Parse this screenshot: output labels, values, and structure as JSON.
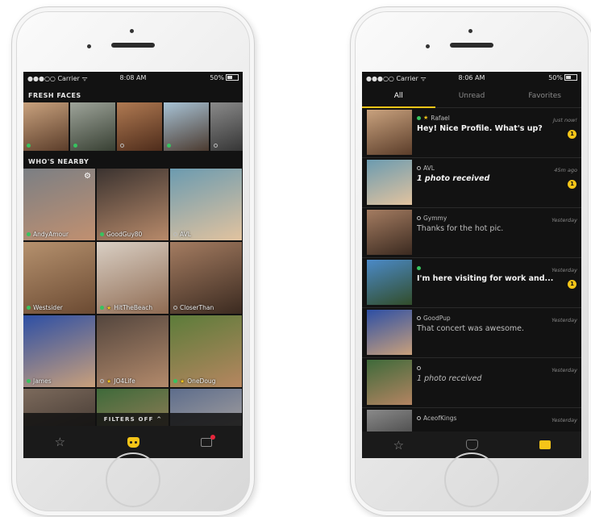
{
  "left_phone": {
    "status": {
      "carrier": "●●●○○ Carrier ᯤ",
      "time": "8:08 AM",
      "battery": "50%"
    },
    "fresh_faces": {
      "title": "FRESH FACES",
      "faces": [
        {
          "status": "online"
        },
        {
          "status": "online"
        },
        {
          "status": "away"
        },
        {
          "status": "online"
        },
        {
          "status": "away"
        }
      ]
    },
    "whos_nearby": {
      "title": "WHO'S NEARBY",
      "profiles": [
        {
          "name": "AndyAmour",
          "status": "online",
          "favorite": false
        },
        {
          "name": "GoodGuy80",
          "status": "online",
          "favorite": false
        },
        {
          "name": "AVL",
          "status": "away",
          "favorite": false
        },
        {
          "name": "Westsider",
          "status": "online",
          "favorite": false
        },
        {
          "name": "HitTheBeach",
          "status": "online",
          "favorite": true
        },
        {
          "name": "CloserThan",
          "status": "away",
          "favorite": false
        },
        {
          "name": "James",
          "status": "online",
          "favorite": false
        },
        {
          "name": "JO4Life",
          "status": "away",
          "favorite": true
        },
        {
          "name": "OneDoug",
          "status": "online",
          "favorite": true
        }
      ]
    },
    "filters_label": "FILTERS OFF ^",
    "tab_icons": [
      "star-icon",
      "grindr-mask-icon",
      "chat-icon"
    ]
  },
  "right_phone": {
    "status": {
      "carrier": "●●●○○ Carrier ᯤ",
      "time": "8:06 AM",
      "battery": "50%"
    },
    "tabs": [
      "All",
      "Unread",
      "Favorites"
    ],
    "active_tab": "All",
    "messages": [
      {
        "name": "Rafael",
        "status": "online",
        "favorite": true,
        "time": "Just now!",
        "text": "Hey! Nice Profile. What's up?",
        "unread": "1",
        "style": "bold"
      },
      {
        "name": "AVL",
        "status": "away",
        "favorite": false,
        "time": "45m ago",
        "text": "1 photo received",
        "unread": "1",
        "style": "bold-italic"
      },
      {
        "name": "Gymmy",
        "status": "away",
        "favorite": false,
        "time": "Yesterday",
        "text": "Thanks for the hot pic.",
        "unread": "",
        "style": "dim"
      },
      {
        "name": "",
        "status": "online",
        "favorite": false,
        "time": "Yesterday",
        "text": "I'm here visiting for work and...",
        "unread": "1",
        "style": "bold"
      },
      {
        "name": "GoodPup",
        "status": "away",
        "favorite": false,
        "time": "Yesterday",
        "text": "That concert was awesome.",
        "unread": "",
        "style": "dim"
      },
      {
        "name": "",
        "status": "away",
        "favorite": false,
        "time": "Yesterday",
        "text": "1 photo received",
        "unread": "",
        "style": "italic"
      },
      {
        "name": "AceofKings",
        "status": "away",
        "favorite": false,
        "time": "Yesterday",
        "text": "",
        "unread": "",
        "style": "dim"
      }
    ],
    "tab_icons": [
      "star-icon",
      "grindr-mask-icon",
      "chat-icon"
    ]
  },
  "colors": {
    "accent": "#f5c518",
    "online": "#37c35f",
    "notification": "#e8263b",
    "background": "#121212"
  }
}
